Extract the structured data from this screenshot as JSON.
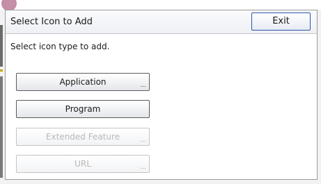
{
  "dialog": {
    "title": "Select Icon to Add",
    "exit_label": "Exit",
    "prompt": "Select icon type to add."
  },
  "options": [
    {
      "label": "Application",
      "ellipsis": "...",
      "enabled": true
    },
    {
      "label": "Program",
      "ellipsis": "",
      "enabled": true
    },
    {
      "label": "Extended Feature",
      "ellipsis": "...",
      "enabled": false
    },
    {
      "label": "URL",
      "ellipsis": "...",
      "enabled": false
    }
  ]
}
